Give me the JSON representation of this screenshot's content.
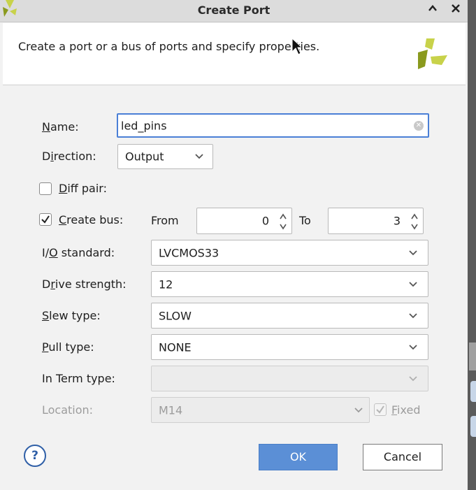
{
  "window": {
    "title": "Create Port",
    "collapse_glyph": "^",
    "close_glyph": "×"
  },
  "header": {
    "description": "Create a port or a bus of ports and specify properties."
  },
  "form": {
    "name": {
      "label_prefix": "",
      "label_key": "N",
      "label_rest": "ame:",
      "value": "led_pins"
    },
    "direction": {
      "label_prefix": "D",
      "label_key": "i",
      "label_rest": "rection:",
      "value": "Output"
    },
    "diff_pair": {
      "label_prefix": "",
      "label_key": "D",
      "label_rest": "iff pair:",
      "checked": false
    },
    "create_bus": {
      "label_prefix": "",
      "label_key": "C",
      "label_rest": "reate bus:",
      "checked": true,
      "from_label": "From",
      "from_value": "0",
      "to_label": "To",
      "to_value": "3"
    },
    "io_standard": {
      "label_prefix": "I/",
      "label_key": "O",
      "label_rest": " standard:",
      "value": "LVCMOS33"
    },
    "drive_strength": {
      "label_prefix": "D",
      "label_key": "r",
      "label_rest": "ive strength:",
      "value": "12"
    },
    "slew_type": {
      "label_prefix": "",
      "label_key": "S",
      "label_rest": "lew type:",
      "value": "SLOW"
    },
    "pull_type": {
      "label_prefix": "",
      "label_key": "P",
      "label_rest": "ull type:",
      "value": "NONE"
    },
    "in_term_type": {
      "label": "In Term type:",
      "value": ""
    },
    "location": {
      "label": "Location:",
      "value": "M14",
      "fixed_key": "F",
      "fixed_rest": "ixed",
      "fixed_checked": true
    }
  },
  "footer": {
    "help_glyph": "?",
    "ok_label": "OK",
    "cancel_label": "Cancel"
  },
  "colors": {
    "accent": "#4a7fd6",
    "ok_button": "#5b8fd6",
    "logo_yellow": "#c8d24a",
    "logo_olive": "#8a9a1e"
  },
  "icons": [
    "xilinx-logo-icon",
    "chevron-up-icon",
    "close-icon",
    "clear-icon",
    "chevron-down-icon",
    "spinner-icon",
    "checkmark-icon",
    "help-icon"
  ]
}
